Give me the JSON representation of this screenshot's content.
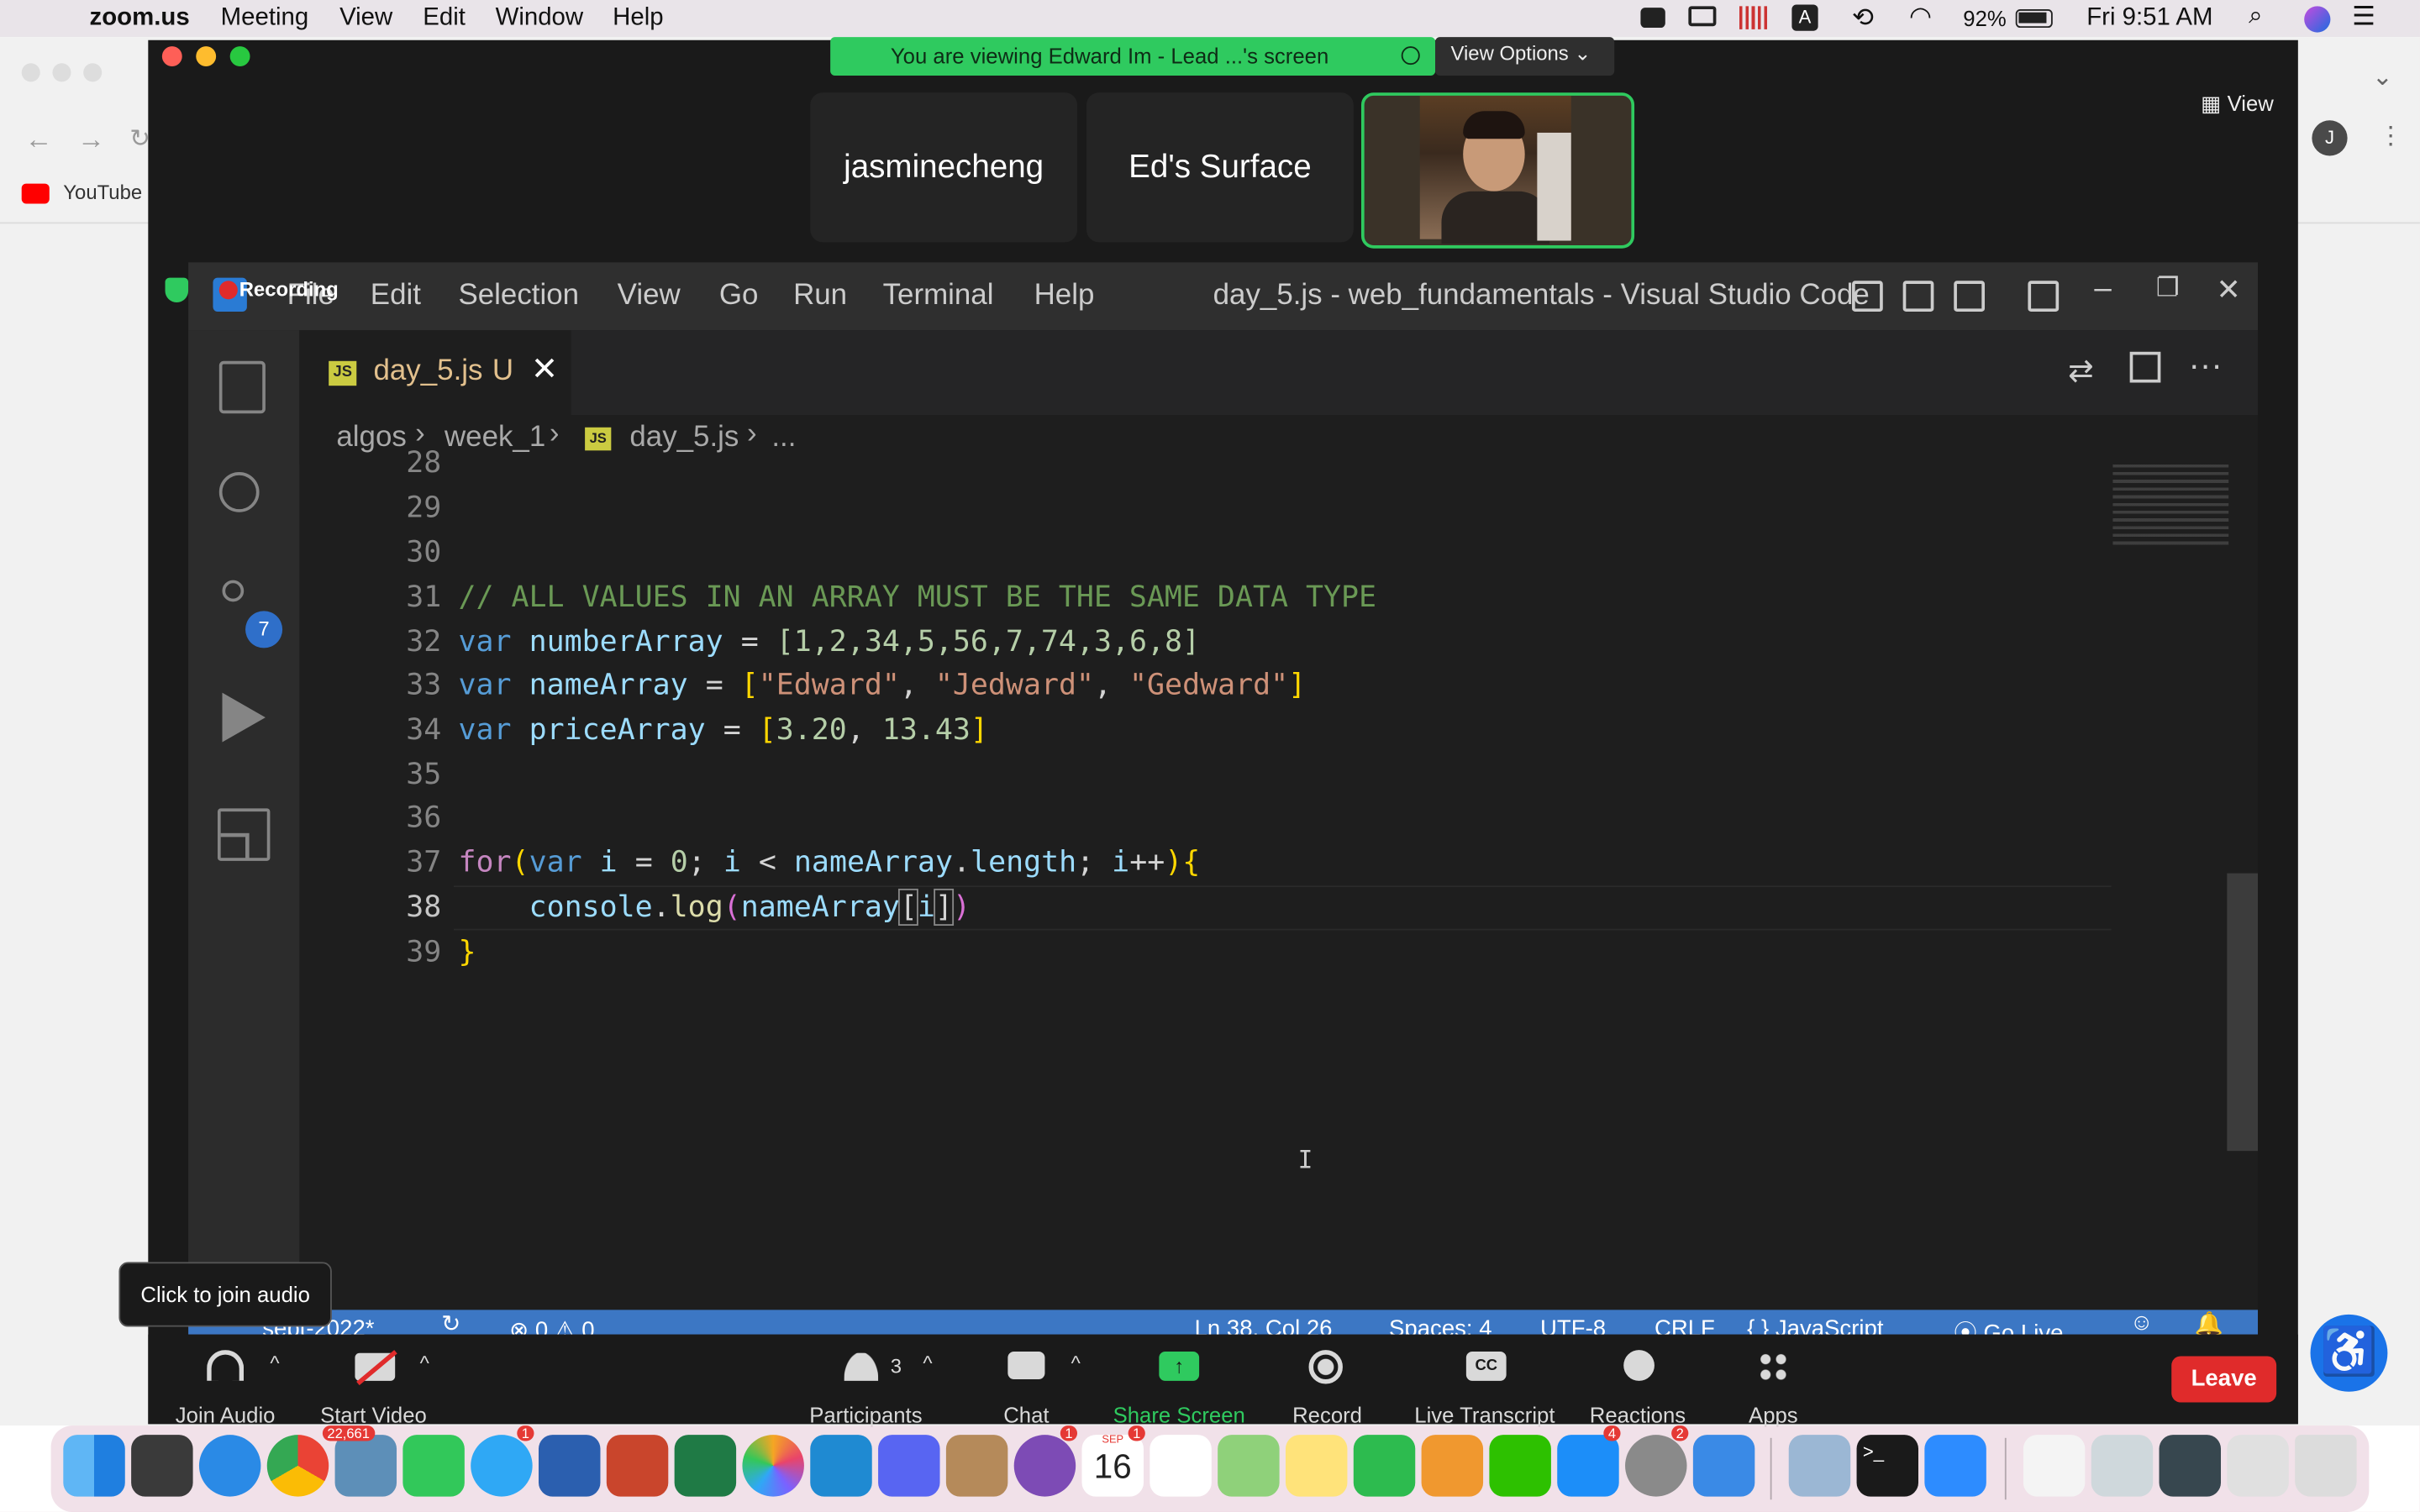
{
  "menubar": {
    "app": "zoom.us",
    "items": [
      "Meeting",
      "View",
      "Edit",
      "Window",
      "Help"
    ],
    "battery": "92%",
    "clock": "Fri 9:51 AM"
  },
  "browser": {
    "bookmark": "YouTube",
    "profile_initial": "J"
  },
  "zoom": {
    "share_banner": "You are viewing Edward Im - Lead ...'s screen",
    "view_options": "View Options",
    "view_label": "View",
    "tiles": [
      "jasminecheng",
      "Ed's Surface"
    ],
    "recording_label": "Recording",
    "audio_tooltip": "Click to join audio",
    "toolbar": {
      "join_audio": "Join Audio",
      "start_video": "Start Video",
      "participants": "Participants",
      "participants_count": "3",
      "chat": "Chat",
      "share_screen": "Share Screen",
      "record": "Record",
      "live_transcript": "Live Transcript",
      "reactions": "Reactions",
      "apps": "Apps",
      "leave": "Leave"
    }
  },
  "vscode": {
    "menu": [
      "File",
      "Edit",
      "Selection",
      "View",
      "Go",
      "Run",
      "Terminal",
      "Help"
    ],
    "window_title": "day_5.js - web_fundamentals - Visual Studio Code",
    "tab": {
      "name": "day_5.js",
      "status": "U",
      "icon": "JS"
    },
    "breadcrumb": [
      "algos",
      "week_1",
      "day_5.js",
      "..."
    ],
    "scm_badge": "7",
    "line_numbers": [
      "28",
      "29",
      "30",
      "31",
      "32",
      "33",
      "34",
      "35",
      "36",
      "37",
      "38",
      "39"
    ],
    "code": {
      "comment": "// ALL VALUES IN AN ARRAY MUST BE THE SAME DATA TYPE",
      "number_array": "[1,2,34,5,56,7,74,3,6,8]",
      "name_array_values": [
        "\"Edward\"",
        "\"Jedward\"",
        "\"Gedward\""
      ],
      "price_array_values": [
        "3.20",
        "13.43"
      ]
    },
    "status": {
      "branch": "sept-2022*",
      "errors": "0",
      "warnings": "0",
      "position": "Ln 38, Col 26",
      "spaces": "Spaces: 4",
      "encoding": "UTF-8",
      "eol": "CRLF",
      "language": "JavaScript",
      "go_live": "Go Live"
    }
  },
  "dock": {
    "badges": {
      "mail": "22,661",
      "messages": "1",
      "calendar_month": "SEP",
      "calendar_day": "16",
      "notion": "1",
      "calendar": "1",
      "appstore": "4",
      "settings": "2"
    }
  },
  "colors": {
    "vscode_status": "#3c77c4",
    "share_green": "#2fca5f",
    "leave_red": "#e02b2b",
    "accessibility_blue": "#1a73e8"
  }
}
